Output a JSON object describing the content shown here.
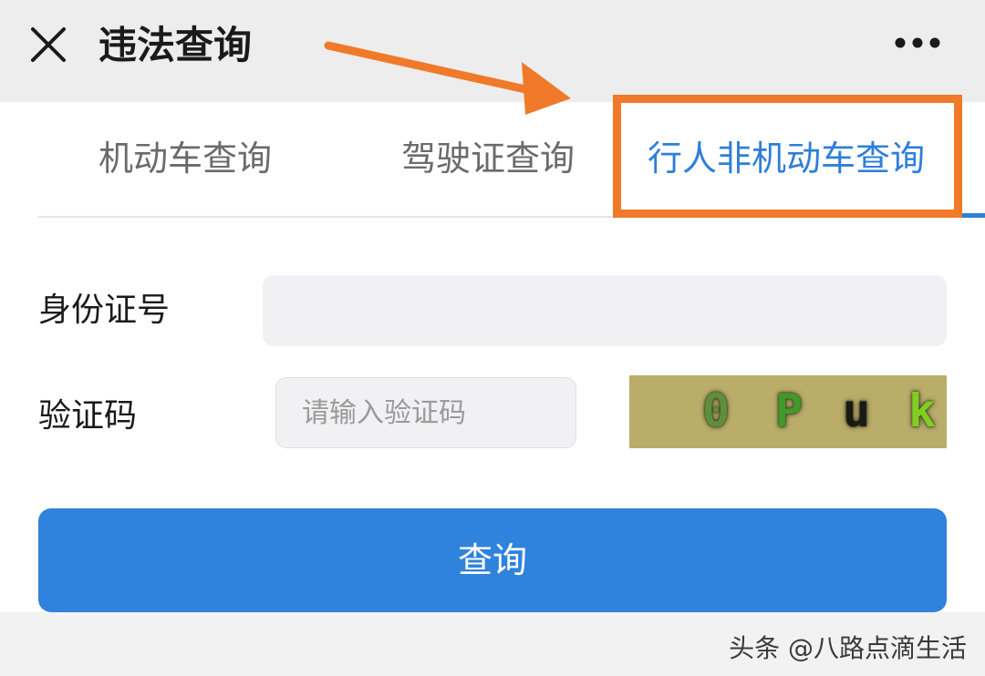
{
  "header": {
    "close_icon": "close-icon",
    "title": "违法查询",
    "more_icon": "more-dots-icon"
  },
  "tabs": [
    {
      "label": "机动车查询",
      "active": false
    },
    {
      "label": "驾驶证查询",
      "active": false
    },
    {
      "label": "行人非机动车查询",
      "active": true
    }
  ],
  "form": {
    "id_label": "身份证号",
    "id_value": "",
    "captcha_label": "验证码",
    "captcha_placeholder": "请输入验证码",
    "captcha_chars": [
      {
        "char": "0",
        "color": "#5e8f3a"
      },
      {
        "char": "P",
        "color": "#3f9a2a"
      },
      {
        "char": "u",
        "color": "#1a1a14"
      },
      {
        "char": "k",
        "color": "#7fcf23"
      }
    ],
    "submit_label": "查询"
  },
  "annotations": {
    "highlight_color": "#f07a2a"
  },
  "watermark": "头条 @八路点滴生活",
  "colors": {
    "accent": "#2e7fd9",
    "button": "#2f83dc",
    "captcha_bg": "#b9ad69"
  }
}
